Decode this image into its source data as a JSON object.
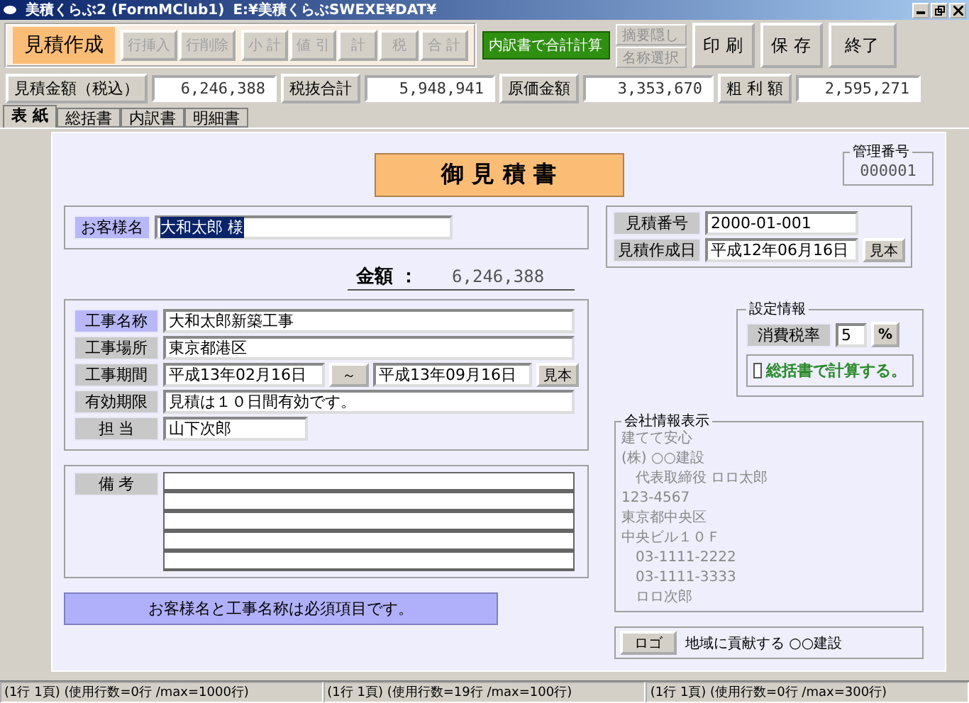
{
  "window": {
    "title": "美積くらぶ2 (FormMClub1)",
    "path": "E:¥美積くらぶSWEXE¥DAT¥"
  },
  "toolbar": {
    "mode": "見積作成",
    "row_buttons": [
      {
        "label": "行挿入",
        "disabled": true
      },
      {
        "label": "行削除",
        "disabled": true
      }
    ],
    "calc_buttons": [
      {
        "label": "小 計",
        "disabled": true
      },
      {
        "label": "値 引",
        "disabled": true
      },
      {
        "label": "計",
        "disabled": true
      },
      {
        "label": "税",
        "disabled": true
      },
      {
        "label": "合 計",
        "disabled": true
      }
    ],
    "action_button": {
      "label": "内訳書で合計計算"
    },
    "option_buttons": [
      {
        "label": "摘要隠し",
        "disabled": true
      },
      {
        "label": "名称選択",
        "disabled": true
      }
    ],
    "main_buttons": [
      {
        "label": "印 刷"
      },
      {
        "label": "保 存"
      },
      {
        "label": "終了"
      }
    ]
  },
  "summary": [
    {
      "label": "見積金額（税込）",
      "value": "6,246,388"
    },
    {
      "label": "税抜合計",
      "value": "5,948,941"
    },
    {
      "label": "原価金額",
      "value": "3,353,670"
    },
    {
      "label": "粗 利 額",
      "value": "2,595,271"
    }
  ],
  "tabs": [
    {
      "label": "表 紙",
      "selected": true
    },
    {
      "label": "総括書",
      "selected": false
    },
    {
      "label": "内訳書",
      "selected": false
    },
    {
      "label": "明細書",
      "selected": false
    }
  ],
  "cover": {
    "heading": "御 見 積 書",
    "management": {
      "legend": "管理番号",
      "value": "000001"
    },
    "customer": {
      "label": "お客様名",
      "required": true,
      "value": "大和太郎 様",
      "highlighted": true
    },
    "estimate": {
      "number_label": "見積番号",
      "number": "2000-01-001",
      "date_label": "見積作成日",
      "date": "平成12年06月16日",
      "sample_button": "見本"
    },
    "amount": {
      "label": "金額 ：",
      "value": "6,246,388"
    },
    "project": [
      {
        "kind": "text",
        "label": "工事名称",
        "required": true,
        "value": "大和太郎新築工事"
      },
      {
        "kind": "text",
        "label": "工事場所",
        "required": false,
        "value": "東京都港区"
      },
      {
        "kind": "period",
        "label": "工事期間",
        "required": false,
        "from": "平成13年02月16日",
        "range_button": "～",
        "to": "平成13年09月16日",
        "sample_button": "見本"
      },
      {
        "kind": "text",
        "label": "有効期限",
        "required": false,
        "value": "見積は１０日間有効です。"
      },
      {
        "kind": "short",
        "label": "担 当",
        "required": false,
        "value": "山下次郎"
      }
    ],
    "remarks": {
      "label": "備 考"
    },
    "settings": {
      "legend": "設定情報",
      "tax_label": "消費税率",
      "tax_rate": "5",
      "percent_button": "%",
      "checkbox": {
        "label": "総括書で計算する。",
        "checked": false
      }
    },
    "company": {
      "legend": "会社情報表示",
      "lines": [
        "建てて安心",
        "(株) ○○建設",
        "　代表取締役 ロロ太郎",
        "123-4567",
        "東京都中央区",
        "中央ビル１０Ｆ",
        "　03-1111-2222",
        "　03-1111-3333",
        "　ロロ次郎"
      ]
    },
    "notice": "お客様名と工事名称は必須項目です。",
    "logo": {
      "button": "ロゴ",
      "slogan": "地域に貢献する ○○建設"
    }
  },
  "status_bar": [
    "(1行 1頁) (使用行数=0行 /max=1000行)",
    "(1行 1頁) (使用行数=19行 /max=100行)",
    "(1行 1頁) (使用行数=0行 /max=300行)"
  ]
}
